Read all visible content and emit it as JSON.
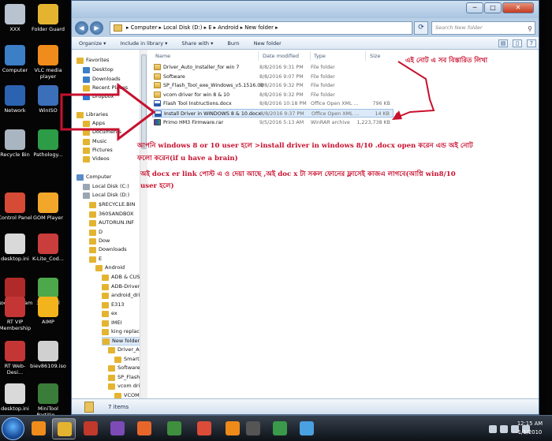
{
  "desktop_icons": [
    {
      "label": "XXX",
      "color": "#b9c2cf"
    },
    {
      "label": "Folder Guard",
      "color": "#e4b431"
    },
    {
      "label": "Computer",
      "color": "#3c7fc7"
    },
    {
      "label": "VLC media player",
      "color": "#f08c1c"
    },
    {
      "label": "Network",
      "color": "#2b63b0"
    },
    {
      "label": "WinISO",
      "color": "#3c6fb9"
    },
    {
      "label": "Recycle Bin",
      "color": "#aab5c2"
    },
    {
      "label": "Pathology...",
      "color": "#2d9c46"
    },
    {
      "label": "Control Panel",
      "color": "#d64b35"
    },
    {
      "label": "GOM Player",
      "color": "#f2a72a"
    },
    {
      "label": "desktop.ini",
      "color": "#d9d9d9"
    },
    {
      "label": "K-Lite_Cod...",
      "color": "#c93d3d"
    },
    {
      "label": "Rockers Team",
      "color": "#b12a2a"
    },
    {
      "label": "360 Total Security",
      "color": "#4ca84a"
    },
    {
      "label": "RT VIP Membership",
      "color": "#c43636"
    },
    {
      "label": "AIMP",
      "color": "#f2b31c"
    },
    {
      "label": "RT Web-Desi...",
      "color": "#c43636"
    },
    {
      "label": "biev86109.iso",
      "color": "#d0d0d0"
    },
    {
      "label": "desktop.ini",
      "color": "#d9d9d9"
    },
    {
      "label": "MiniTool Partitio...",
      "color": "#3a7c3a"
    }
  ],
  "window": {
    "address": "▸ Computer ▸ Local Disk (D:) ▸ E ▸ Android ▸ New folder ▸",
    "search_placeholder": "Search New folder",
    "toolbar": [
      "Organize ▾",
      "Include in library ▾",
      "Share with ▾",
      "Burn",
      "New folder"
    ],
    "status": "7 items"
  },
  "nav": [
    {
      "label": "Favorites",
      "color": "#e4b431"
    },
    {
      "label": "Desktop",
      "color": "#3c7fc7"
    },
    {
      "label": "Downloads",
      "color": "#3c7fc7"
    },
    {
      "label": "Recent Places",
      "color": "#e4b431"
    },
    {
      "label": "Dropbox",
      "color": "#2a77d6"
    },
    {
      "label": "Libraries",
      "color": "#e4b431"
    },
    {
      "label": "Apps",
      "color": "#e4b431"
    },
    {
      "label": "Documents",
      "color": "#e4b431"
    },
    {
      "label": "Music",
      "color": "#e4b431"
    },
    {
      "label": "Pictures",
      "color": "#e4b431"
    },
    {
      "label": "Videos",
      "color": "#e4b431"
    },
    {
      "label": "Computer",
      "color": "#5a8bc7"
    },
    {
      "label": "Local Disk (C:)",
      "color": "#9aa6b3"
    },
    {
      "label": "Local Disk (D:)",
      "color": "#9aa6b3"
    },
    {
      "label": "$RECYCLE.BIN",
      "color": "#e4b431"
    },
    {
      "label": "360SANDBOX",
      "color": "#e4b431"
    },
    {
      "label": "AUTORUN.INF",
      "color": "#e4b431"
    },
    {
      "label": "D",
      "color": "#e4b431"
    },
    {
      "label": "Dow",
      "color": "#e4b431"
    },
    {
      "label": "Downloads",
      "color": "#e4b431"
    },
    {
      "label": "E",
      "color": "#e4b431"
    },
    {
      "label": "Android",
      "color": "#e4b431"
    },
    {
      "label": "ADB & CUSI",
      "color": "#e4b431"
    },
    {
      "label": "ADB-Driver-",
      "color": "#e4b431"
    },
    {
      "label": "android_driv",
      "color": "#e4b431"
    },
    {
      "label": "E313",
      "color": "#e4b431"
    },
    {
      "label": "ex",
      "color": "#e4b431"
    },
    {
      "label": "IMEI",
      "color": "#e4b431"
    },
    {
      "label": "king replace",
      "color": "#e4b431"
    },
    {
      "label": "New folder",
      "color": "#e4b431"
    },
    {
      "label": "Driver_Aut",
      "color": "#e4b431"
    },
    {
      "label": "SmartPh",
      "color": "#e4b431"
    },
    {
      "label": "Software",
      "color": "#e4b431"
    },
    {
      "label": "SP_Flash_T",
      "color": "#e4b431"
    },
    {
      "label": "vcom driv",
      "color": "#e4b431"
    },
    {
      "label": "VCOM",
      "color": "#e4b431"
    }
  ],
  "columns": {
    "name": "Name",
    "date": "Date modified",
    "type": "Type",
    "size": "Size"
  },
  "files": [
    {
      "name": "Driver_Auto_Installer_for win 7",
      "date": "8/8/2016 9:31 PM",
      "type": "File folder",
      "size": "",
      "kind": "folder"
    },
    {
      "name": "Software",
      "date": "8/8/2016 9:07 PM",
      "type": "File folder",
      "size": "",
      "kind": "folder"
    },
    {
      "name": "SP_Flash_Tool_exe_Windows_v5.1516.00",
      "date": "8/8/2016 9:32 PM",
      "type": "File folder",
      "size": "",
      "kind": "folder"
    },
    {
      "name": "vcom driver for win 8 & 10",
      "date": "8/8/2016 9:32 PM",
      "type": "File folder",
      "size": "",
      "kind": "folder"
    },
    {
      "name": "Flash Tool Instructions.docx",
      "date": "8/8/2016 10:18 PM",
      "type": "Office Open XML ...",
      "size": "796 KB",
      "kind": "doc"
    },
    {
      "name": "Install Driver in WINDOWS 8 & 10.docx",
      "date": "8/8/2016 9:37 PM",
      "type": "Office Open XML ...",
      "size": "14 KB",
      "kind": "doc"
    },
    {
      "name": "Primo HM3 Firmware.rar",
      "date": "9/5/2016 5:13 AM",
      "type": "WinRAR archive",
      "size": "1,223,738 KB",
      "kind": "rar"
    }
  ],
  "annotations": {
    "note_top": "এই নোট এ সব বিস্তারিত লিখা",
    "note_main": "আপনি windows 8 or 10 user হলে >install driver in windows 8/10 .docx open করেন এন্ড অই নোট ফলো করেন(if u have a brain)",
    "note_sub": "অই docx er link পোস্ট এ ও দেয়া আছে ,অই doc x টা সকল  ফোনের ফ্লাসেই কাজএ লাগবে(আপ্নি win8/10 user হলে)",
    "color": "#c8102e"
  },
  "taskbar": {
    "apps": [
      {
        "name": "media-player",
        "color": "#f08c1c"
      },
      {
        "name": "explorer",
        "color": "#e4b431",
        "active": true
      },
      {
        "name": "recorder",
        "color": "#c0392b"
      },
      {
        "name": "visual-studio",
        "color": "#7c4bb5"
      },
      {
        "name": "firefox",
        "color": "#e8662a"
      },
      {
        "name": "idm",
        "color": "#3f8f3f"
      },
      {
        "name": "chrome",
        "color": "#dd4b39"
      },
      {
        "name": "origin",
        "color": "#ee8a1a"
      },
      {
        "name": "dvd",
        "color": "#555"
      },
      {
        "name": "game",
        "color": "#3a9a4a"
      },
      {
        "name": "bluestacks",
        "color": "#4aa0e0"
      }
    ],
    "time": "12:15 AM",
    "date": "1/1/2010"
  }
}
